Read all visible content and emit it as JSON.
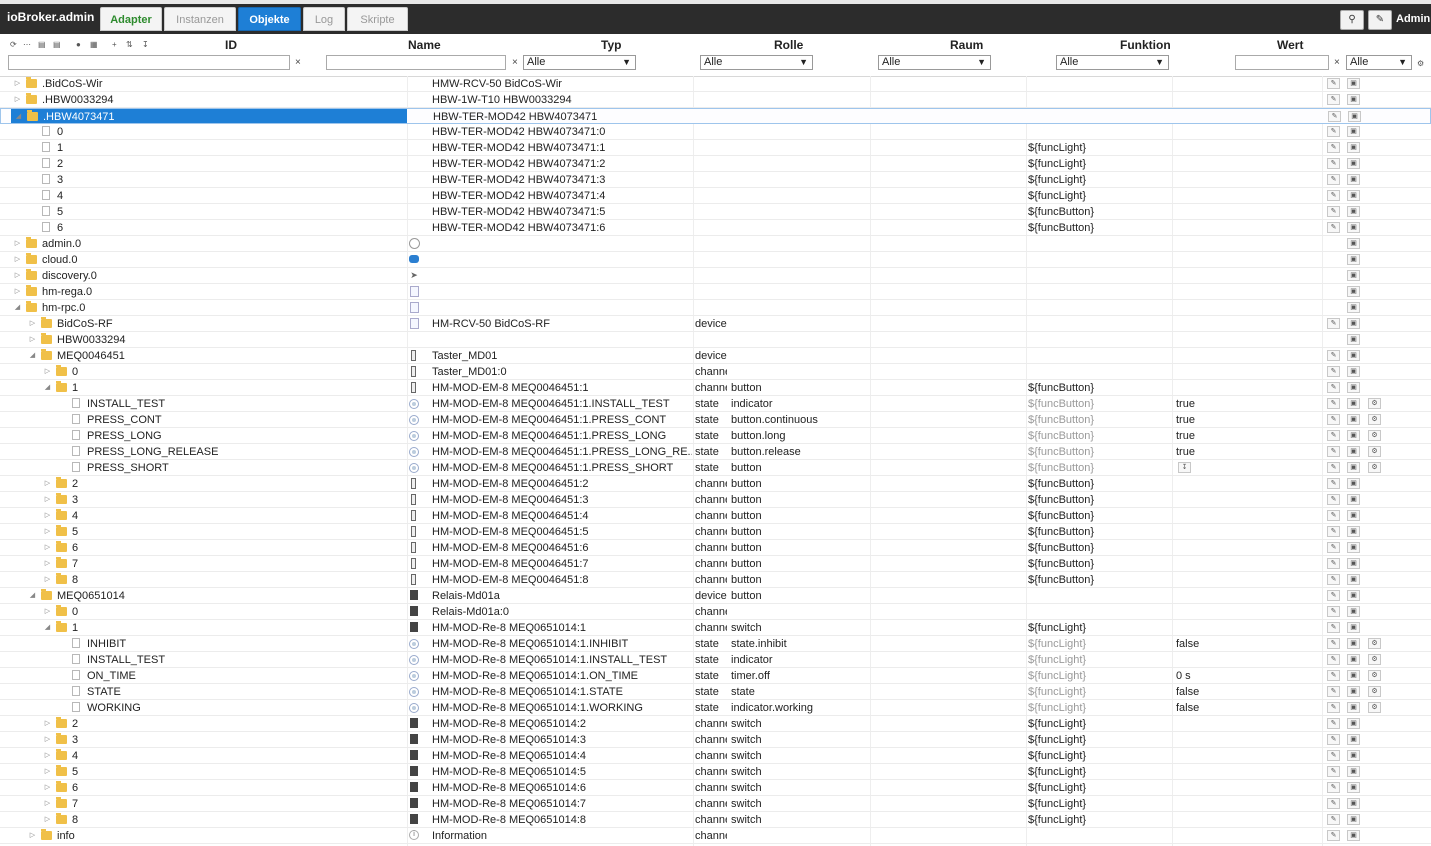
{
  "app": {
    "title": "ioBroker.admin",
    "user": "Admin"
  },
  "tabs": [
    {
      "label": "Adapter"
    },
    {
      "label": "Instanzen"
    },
    {
      "label": "Objekte"
    },
    {
      "label": "Log"
    },
    {
      "label": "Skripte"
    }
  ],
  "columns": {
    "id": "ID",
    "name": "Name",
    "typ": "Typ",
    "rolle": "Rolle",
    "raum": "Raum",
    "funktion": "Funktion",
    "wert": "Wert"
  },
  "filters": {
    "typ": "Alle",
    "rolle": "Alle",
    "raum": "Alle",
    "funktion": "Alle",
    "wert": "Alle",
    "clear": "×"
  },
  "toolbar_icons": [
    "refresh-icon",
    "collapse-icon",
    "folder-open-icon",
    "folder-icon",
    "user-icon",
    "columns-icon",
    "add-icon",
    "sort-icon",
    "download-icon"
  ],
  "rows": [
    {
      "id": ".BidCoS-Wir",
      "name": "HMW-RCV-50 BidCoS-Wir",
      "typ": "",
      "rolle": "",
      "funktion": "",
      "wert": "",
      "level": 0,
      "kind": "folder",
      "exp": "collapsed",
      "icon": "",
      "btns": [
        "edit",
        "delete"
      ]
    },
    {
      "id": ".HBW0033294",
      "name": "HBW-1W-T10 HBW0033294",
      "typ": "",
      "rolle": "",
      "funktion": "",
      "wert": "",
      "level": 0,
      "kind": "folder",
      "exp": "collapsed",
      "icon": "",
      "btns": [
        "edit",
        "delete"
      ]
    },
    {
      "id": ".HBW4073471",
      "name": "HBW-TER-MOD42 HBW4073471",
      "typ": "",
      "rolle": "",
      "funktion": "",
      "wert": "",
      "level": 0,
      "kind": "folder",
      "exp": "expanded",
      "icon": "",
      "btns": [
        "edit",
        "delete"
      ],
      "selected": true
    },
    {
      "id": "0",
      "name": "HBW-TER-MOD42 HBW4073471:0",
      "typ": "",
      "rolle": "",
      "funktion": "",
      "wert": "",
      "level": 1,
      "kind": "file",
      "exp": "",
      "icon": "",
      "btns": [
        "edit",
        "delete"
      ]
    },
    {
      "id": "1",
      "name": "HBW-TER-MOD42 HBW4073471:1",
      "typ": "",
      "rolle": "",
      "funktion": "${funcLight}",
      "wert": "",
      "level": 1,
      "kind": "file",
      "exp": "",
      "icon": "",
      "btns": [
        "edit",
        "delete"
      ]
    },
    {
      "id": "2",
      "name": "HBW-TER-MOD42 HBW4073471:2",
      "typ": "",
      "rolle": "",
      "funktion": "${funcLight}",
      "wert": "",
      "level": 1,
      "kind": "file",
      "exp": "",
      "icon": "",
      "btns": [
        "edit",
        "delete"
      ]
    },
    {
      "id": "3",
      "name": "HBW-TER-MOD42 HBW4073471:3",
      "typ": "",
      "rolle": "",
      "funktion": "${funcLight}",
      "wert": "",
      "level": 1,
      "kind": "file",
      "exp": "",
      "icon": "",
      "btns": [
        "edit",
        "delete"
      ]
    },
    {
      "id": "4",
      "name": "HBW-TER-MOD42 HBW4073471:4",
      "typ": "",
      "rolle": "",
      "funktion": "${funcLight}",
      "wert": "",
      "level": 1,
      "kind": "file",
      "exp": "",
      "icon": "",
      "btns": [
        "edit",
        "delete"
      ]
    },
    {
      "id": "5",
      "name": "HBW-TER-MOD42 HBW4073471:5",
      "typ": "",
      "rolle": "",
      "funktion": "${funcButton}",
      "wert": "",
      "level": 1,
      "kind": "file",
      "exp": "",
      "icon": "",
      "btns": [
        "edit",
        "delete"
      ]
    },
    {
      "id": "6",
      "name": "HBW-TER-MOD42 HBW4073471:6",
      "typ": "",
      "rolle": "",
      "funktion": "${funcButton}",
      "wert": "",
      "level": 1,
      "kind": "file",
      "exp": "",
      "icon": "",
      "btns": [
        "edit",
        "delete"
      ]
    },
    {
      "id": "admin.0",
      "name": "",
      "typ": "",
      "rolle": "",
      "funktion": "",
      "wert": "",
      "level": 0,
      "kind": "folder",
      "exp": "collapsed",
      "icon": "adapter",
      "btns": [
        "delete"
      ]
    },
    {
      "id": "cloud.0",
      "name": "",
      "typ": "",
      "rolle": "",
      "funktion": "",
      "wert": "",
      "level": 0,
      "kind": "folder",
      "exp": "collapsed",
      "icon": "cloud",
      "btns": [
        "delete"
      ]
    },
    {
      "id": "discovery.0",
      "name": "",
      "typ": "",
      "rolle": "",
      "funktion": "",
      "wert": "",
      "level": 0,
      "kind": "folder",
      "exp": "collapsed",
      "icon": "discovery",
      "btns": [
        "delete"
      ]
    },
    {
      "id": "hm-rega.0",
      "name": "",
      "typ": "",
      "rolle": "",
      "funktion": "",
      "wert": "",
      "level": 0,
      "kind": "folder",
      "exp": "collapsed",
      "icon": "page",
      "btns": [
        "delete"
      ]
    },
    {
      "id": "hm-rpc.0",
      "name": "",
      "typ": "",
      "rolle": "",
      "funktion": "",
      "wert": "",
      "level": 0,
      "kind": "folder",
      "exp": "expanded",
      "icon": "page",
      "btns": [
        "delete"
      ]
    },
    {
      "id": "BidCoS-RF",
      "name": "HM-RCV-50 BidCoS-RF",
      "typ": "device",
      "rolle": "",
      "funktion": "",
      "wert": "",
      "level": 1,
      "kind": "folder",
      "exp": "collapsed",
      "icon": "device-outline",
      "btns": [
        "edit",
        "delete"
      ]
    },
    {
      "id": "HBW0033294",
      "name": "",
      "typ": "",
      "rolle": "",
      "funktion": "",
      "wert": "",
      "level": 1,
      "kind": "folder",
      "exp": "collapsed",
      "icon": "",
      "btns": [
        "delete"
      ]
    },
    {
      "id": "MEQ0046451",
      "name": "Taster_MD01",
      "typ": "device",
      "rolle": "",
      "funktion": "",
      "wert": "",
      "level": 1,
      "kind": "folder",
      "exp": "expanded",
      "icon": "chan",
      "btns": [
        "edit",
        "delete"
      ]
    },
    {
      "id": "0",
      "name": "Taster_MD01:0",
      "typ": "channe",
      "rolle": "",
      "funktion": "",
      "wert": "",
      "level": 2,
      "kind": "folder",
      "exp": "collapsed",
      "icon": "chan",
      "btns": [
        "edit",
        "delete"
      ]
    },
    {
      "id": "1",
      "name": "HM-MOD-EM-8 MEQ0046451:1",
      "typ": "channe",
      "rolle": "button",
      "funktion": "${funcButton}",
      "wert": "",
      "level": 2,
      "kind": "folder",
      "exp": "expanded",
      "icon": "chan",
      "btns": [
        "edit",
        "delete"
      ]
    },
    {
      "id": "INSTALL_TEST",
      "name": "HM-MOD-EM-8 MEQ0046451:1.INSTALL_TEST",
      "typ": "state",
      "rolle": "indicator",
      "funktion": "${funcButton}",
      "wert": "true",
      "level": 3,
      "kind": "file",
      "exp": "",
      "icon": "state",
      "btns": [
        "edit",
        "delete",
        "gear"
      ],
      "dim": true
    },
    {
      "id": "PRESS_CONT",
      "name": "HM-MOD-EM-8 MEQ0046451:1.PRESS_CONT",
      "typ": "state",
      "rolle": "button.continuous",
      "funktion": "${funcButton}",
      "wert": "true",
      "level": 3,
      "kind": "file",
      "exp": "",
      "icon": "state",
      "btns": [
        "edit",
        "delete",
        "gear"
      ],
      "dim": true
    },
    {
      "id": "PRESS_LONG",
      "name": "HM-MOD-EM-8 MEQ0046451:1.PRESS_LONG",
      "typ": "state",
      "rolle": "button.long",
      "funktion": "${funcButton}",
      "wert": "true",
      "level": 3,
      "kind": "file",
      "exp": "",
      "icon": "state",
      "btns": [
        "edit",
        "delete",
        "gear"
      ],
      "dim": true
    },
    {
      "id": "PRESS_LONG_RELEASE",
      "name": "HM-MOD-EM-8 MEQ0046451:1.PRESS_LONG_RE...",
      "typ": "state",
      "rolle": "button.release",
      "funktion": "${funcButton}",
      "wert": "true",
      "level": 3,
      "kind": "file",
      "exp": "",
      "icon": "state",
      "btns": [
        "edit",
        "delete",
        "gear"
      ],
      "dim": true
    },
    {
      "id": "PRESS_SHORT",
      "name": "HM-MOD-EM-8 MEQ0046451:1.PRESS_SHORT",
      "typ": "state",
      "rolle": "button",
      "funktion": "${funcButton}",
      "wert": "",
      "level": 3,
      "kind": "file",
      "exp": "",
      "icon": "state",
      "btns": [
        "edit",
        "delete",
        "gear"
      ],
      "dim": true,
      "wertButton": true
    },
    {
      "id": "2",
      "name": "HM-MOD-EM-8 MEQ0046451:2",
      "typ": "channe",
      "rolle": "button",
      "funktion": "${funcButton}",
      "wert": "",
      "level": 2,
      "kind": "folder",
      "exp": "collapsed",
      "icon": "chan",
      "btns": [
        "edit",
        "delete"
      ]
    },
    {
      "id": "3",
      "name": "HM-MOD-EM-8 MEQ0046451:3",
      "typ": "channe",
      "rolle": "button",
      "funktion": "${funcButton}",
      "wert": "",
      "level": 2,
      "kind": "folder",
      "exp": "collapsed",
      "icon": "chan",
      "btns": [
        "edit",
        "delete"
      ]
    },
    {
      "id": "4",
      "name": "HM-MOD-EM-8 MEQ0046451:4",
      "typ": "channe",
      "rolle": "button",
      "funktion": "${funcButton}",
      "wert": "",
      "level": 2,
      "kind": "folder",
      "exp": "collapsed",
      "icon": "chan",
      "btns": [
        "edit",
        "delete"
      ]
    },
    {
      "id": "5",
      "name": "HM-MOD-EM-8 MEQ0046451:5",
      "typ": "channe",
      "rolle": "button",
      "funktion": "${funcButton}",
      "wert": "",
      "level": 2,
      "kind": "folder",
      "exp": "collapsed",
      "icon": "chan",
      "btns": [
        "edit",
        "delete"
      ]
    },
    {
      "id": "6",
      "name": "HM-MOD-EM-8 MEQ0046451:6",
      "typ": "channe",
      "rolle": "button",
      "funktion": "${funcButton}",
      "wert": "",
      "level": 2,
      "kind": "folder",
      "exp": "collapsed",
      "icon": "chan",
      "btns": [
        "edit",
        "delete"
      ]
    },
    {
      "id": "7",
      "name": "HM-MOD-EM-8 MEQ0046451:7",
      "typ": "channe",
      "rolle": "button",
      "funktion": "${funcButton}",
      "wert": "",
      "level": 2,
      "kind": "folder",
      "exp": "collapsed",
      "icon": "chan",
      "btns": [
        "edit",
        "delete"
      ]
    },
    {
      "id": "8",
      "name": "HM-MOD-EM-8 MEQ0046451:8",
      "typ": "channe",
      "rolle": "button",
      "funktion": "${funcButton}",
      "wert": "",
      "level": 2,
      "kind": "folder",
      "exp": "collapsed",
      "icon": "chan",
      "btns": [
        "edit",
        "delete"
      ]
    },
    {
      "id": "MEQ0651014",
      "name": "Relais-Md01a",
      "typ": "device",
      "rolle": "button",
      "funktion": "",
      "wert": "",
      "level": 1,
      "kind": "folder",
      "exp": "expanded",
      "icon": "dev",
      "btns": [
        "edit",
        "delete"
      ]
    },
    {
      "id": "0",
      "name": "Relais-Md01a:0",
      "typ": "channe",
      "rolle": "",
      "funktion": "",
      "wert": "",
      "level": 2,
      "kind": "folder",
      "exp": "collapsed",
      "icon": "dev",
      "btns": [
        "edit",
        "delete"
      ]
    },
    {
      "id": "1",
      "name": "HM-MOD-Re-8 MEQ0651014:1",
      "typ": "channe",
      "rolle": "switch",
      "funktion": "${funcLight}",
      "wert": "",
      "level": 2,
      "kind": "folder",
      "exp": "expanded",
      "icon": "dev",
      "btns": [
        "edit",
        "delete"
      ]
    },
    {
      "id": "INHIBIT",
      "name": "HM-MOD-Re-8 MEQ0651014:1.INHIBIT",
      "typ": "state",
      "rolle": "state.inhibit",
      "funktion": "${funcLight}",
      "wert": "false",
      "level": 3,
      "kind": "file",
      "exp": "",
      "icon": "state",
      "btns": [
        "edit",
        "delete",
        "gear"
      ],
      "dim": true
    },
    {
      "id": "INSTALL_TEST",
      "name": "HM-MOD-Re-8 MEQ0651014:1.INSTALL_TEST",
      "typ": "state",
      "rolle": "indicator",
      "funktion": "${funcLight}",
      "wert": "",
      "level": 3,
      "kind": "file",
      "exp": "",
      "icon": "state",
      "btns": [
        "edit",
        "delete",
        "gear"
      ],
      "dim": true
    },
    {
      "id": "ON_TIME",
      "name": "HM-MOD-Re-8 MEQ0651014:1.ON_TIME",
      "typ": "state",
      "rolle": "timer.off",
      "funktion": "${funcLight}",
      "wert": "0 s",
      "level": 3,
      "kind": "file",
      "exp": "",
      "icon": "state",
      "btns": [
        "edit",
        "delete",
        "gear"
      ],
      "dim": true
    },
    {
      "id": "STATE",
      "name": "HM-MOD-Re-8 MEQ0651014:1.STATE",
      "typ": "state",
      "rolle": "state",
      "funktion": "${funcLight}",
      "wert": "false",
      "level": 3,
      "kind": "file",
      "exp": "",
      "icon": "state",
      "btns": [
        "edit",
        "delete",
        "gear"
      ],
      "dim": true
    },
    {
      "id": "WORKING",
      "name": "HM-MOD-Re-8 MEQ0651014:1.WORKING",
      "typ": "state",
      "rolle": "indicator.working",
      "funktion": "${funcLight}",
      "wert": "false",
      "level": 3,
      "kind": "file",
      "exp": "",
      "icon": "state",
      "btns": [
        "edit",
        "delete",
        "gear"
      ],
      "dim": true
    },
    {
      "id": "2",
      "name": "HM-MOD-Re-8 MEQ0651014:2",
      "typ": "channe",
      "rolle": "switch",
      "funktion": "${funcLight}",
      "wert": "",
      "level": 2,
      "kind": "folder",
      "exp": "collapsed",
      "icon": "dev",
      "btns": [
        "edit",
        "delete"
      ]
    },
    {
      "id": "3",
      "name": "HM-MOD-Re-8 MEQ0651014:3",
      "typ": "channe",
      "rolle": "switch",
      "funktion": "${funcLight}",
      "wert": "",
      "level": 2,
      "kind": "folder",
      "exp": "collapsed",
      "icon": "dev",
      "btns": [
        "edit",
        "delete"
      ]
    },
    {
      "id": "4",
      "name": "HM-MOD-Re-8 MEQ0651014:4",
      "typ": "channe",
      "rolle": "switch",
      "funktion": "${funcLight}",
      "wert": "",
      "level": 2,
      "kind": "folder",
      "exp": "collapsed",
      "icon": "dev",
      "btns": [
        "edit",
        "delete"
      ]
    },
    {
      "id": "5",
      "name": "HM-MOD-Re-8 MEQ0651014:5",
      "typ": "channe",
      "rolle": "switch",
      "funktion": "${funcLight}",
      "wert": "",
      "level": 2,
      "kind": "folder",
      "exp": "collapsed",
      "icon": "dev",
      "btns": [
        "edit",
        "delete"
      ]
    },
    {
      "id": "6",
      "name": "HM-MOD-Re-8 MEQ0651014:6",
      "typ": "channe",
      "rolle": "switch",
      "funktion": "${funcLight}",
      "wert": "",
      "level": 2,
      "kind": "folder",
      "exp": "collapsed",
      "icon": "dev",
      "btns": [
        "edit",
        "delete"
      ]
    },
    {
      "id": "7",
      "name": "HM-MOD-Re-8 MEQ0651014:7",
      "typ": "channe",
      "rolle": "switch",
      "funktion": "${funcLight}",
      "wert": "",
      "level": 2,
      "kind": "folder",
      "exp": "collapsed",
      "icon": "dev",
      "btns": [
        "edit",
        "delete"
      ]
    },
    {
      "id": "8",
      "name": "HM-MOD-Re-8 MEQ0651014:8",
      "typ": "channe",
      "rolle": "switch",
      "funktion": "${funcLight}",
      "wert": "",
      "level": 2,
      "kind": "folder",
      "exp": "collapsed",
      "icon": "dev",
      "btns": [
        "edit",
        "delete"
      ]
    },
    {
      "id": "info",
      "name": "Information",
      "typ": "channe",
      "rolle": "",
      "funktion": "",
      "wert": "",
      "level": 1,
      "kind": "folder",
      "exp": "collapsed",
      "icon": "info",
      "btns": [
        "edit",
        "delete"
      ]
    }
  ]
}
